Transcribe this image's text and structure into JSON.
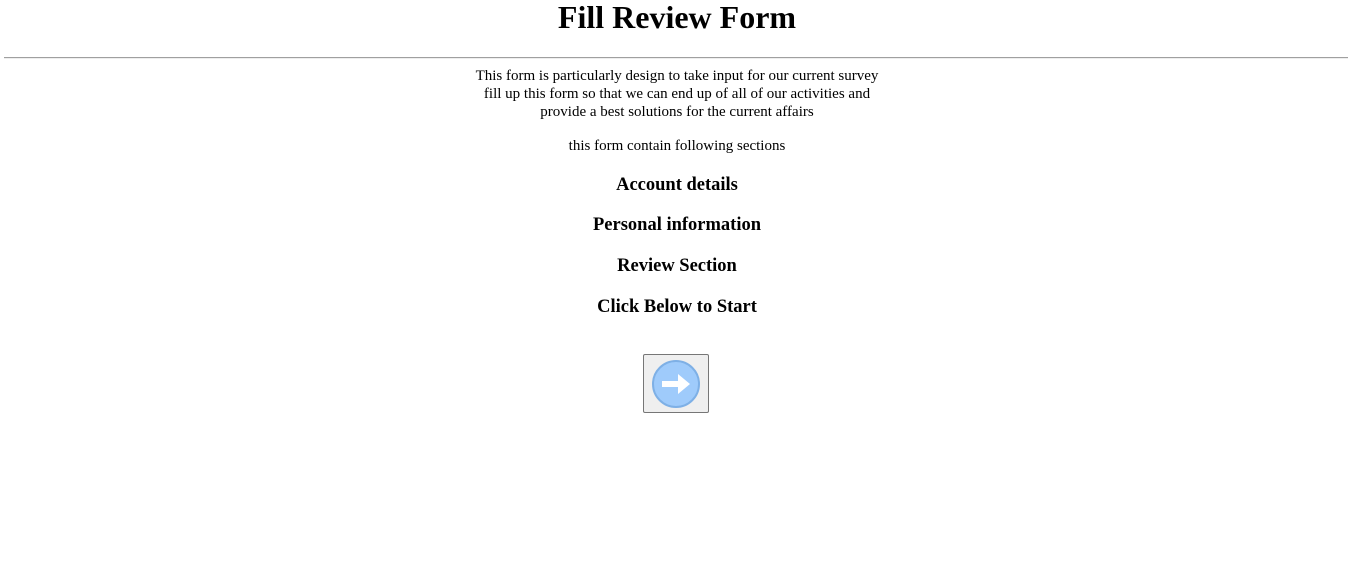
{
  "page": {
    "title": "Fill Review Form",
    "intro_lines": [
      "This form is particularly design to take input for our current survey",
      "fill up this form so that we can end up of all of our activities and",
      "provide a best solutions for the current affairs"
    ],
    "sections_note": "this form contain following sections",
    "sections": [
      "Account details",
      "Personal information",
      "Review Section"
    ],
    "cta_heading": "Click Below to Start"
  },
  "start_button": {
    "icon": "arrow-right-circle-icon",
    "icon_color": "#9fcbfb",
    "icon_border_color": "#7eb0e6",
    "arrow_color": "#ffffff"
  },
  "colors": {
    "background": "#ffffff",
    "text": "#000000",
    "button_face": "#efefef",
    "button_border": "#767676"
  }
}
